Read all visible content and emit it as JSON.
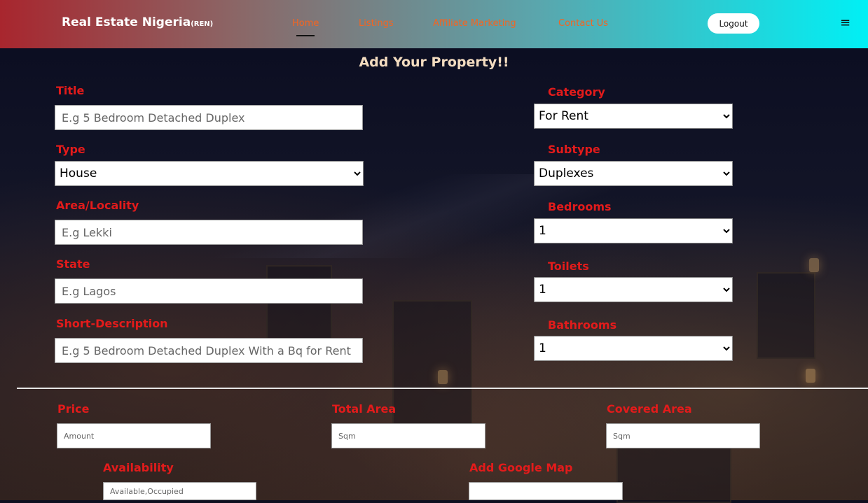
{
  "nav": {
    "brand": "Real Estate Nigeria",
    "brand_suffix": "(REN)",
    "links": [
      "Home",
      "Listings",
      "Affiliate Marketing",
      "Contact Us"
    ],
    "logout": "Logout",
    "menu_icon": "hamburger-icon"
  },
  "form": {
    "heading": "Add Your Property!!",
    "title": {
      "label": "Title",
      "placeholder": "E.g 5 Bedroom Detached Duplex"
    },
    "type": {
      "label": "Type",
      "value": "House"
    },
    "area": {
      "label": "Area/Locality",
      "placeholder": "E.g Lekki"
    },
    "state": {
      "label": "State",
      "placeholder": "E.g Lagos"
    },
    "short_description": {
      "label": "Short-Description",
      "placeholder": "E.g 5 Bedroom Detached Duplex With a Bq for Rent"
    },
    "category": {
      "label": "Category",
      "value": "For Rent"
    },
    "subtype": {
      "label": "Subtype",
      "value": "Duplexes"
    },
    "bedrooms": {
      "label": "Bedrooms",
      "value": "1"
    },
    "toilets": {
      "label": "Toilets",
      "value": "1"
    },
    "bathrooms": {
      "label": "Bathrooms",
      "value": "1"
    },
    "price": {
      "label": "Price",
      "placeholder": "Amount"
    },
    "total_area": {
      "label": "Total Area",
      "placeholder": "Sqm"
    },
    "covered_area": {
      "label": "Covered Area",
      "placeholder": "Sqm"
    },
    "availability": {
      "label": "Availability",
      "placeholder": "Available,Occupied"
    },
    "google_map": {
      "label": "Add Google Map",
      "placeholder": ""
    }
  },
  "colors": {
    "label": "#e31b1b",
    "nav_link": "#f26522",
    "heading": "#f3dcc0"
  }
}
